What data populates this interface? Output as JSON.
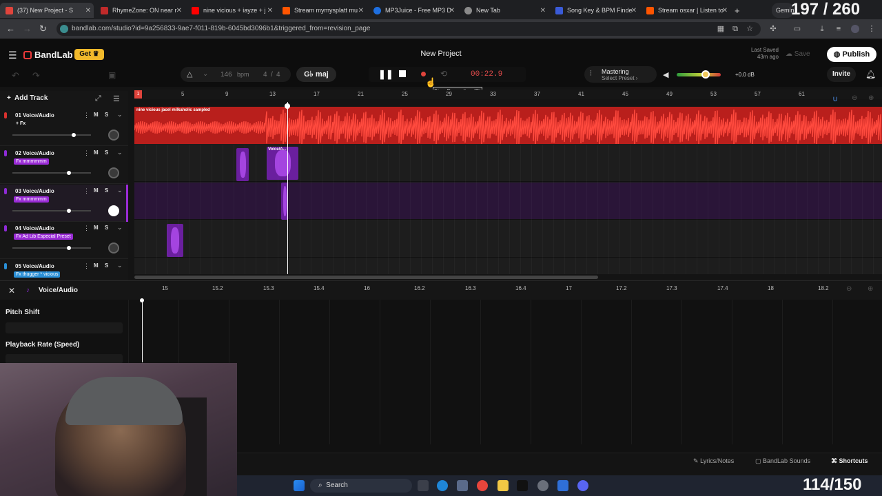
{
  "browser": {
    "tabs": [
      {
        "label": "(37) New Project - S",
        "active": true,
        "favicon_color": "#e0443c"
      },
      {
        "label": "RhymeZone: ON near r",
        "favicon_color": "#c02a2a"
      },
      {
        "label": "nine vicious + iayze + j",
        "favicon_color": "#ff0000"
      },
      {
        "label": "Stream mymysplatt mu",
        "favicon_color": "#ff5500"
      },
      {
        "label": "MP3Juice - Free MP3 D",
        "favicon_color": "#1e6fe0"
      },
      {
        "label": "New Tab",
        "favicon_color": "#8a8a8a"
      },
      {
        "label": "Song Key & BPM Finde",
        "favicon_color": "#3a5bd8"
      },
      {
        "label": "Stream osxar | Listen to",
        "favicon_color": "#ff5500"
      }
    ],
    "new_tab": "+",
    "gemini_label": "Gemini",
    "url": "bandlab.com/studio?id=9a256833-9ae7-f011-819b-6045bd3096b1&triggered_from=revision_page"
  },
  "app": {
    "brand": "BandLab",
    "get_label": "Get",
    "project_title": "New Project",
    "last_saved_label": "Last Saved",
    "last_saved_value": "43m ago",
    "save_label": "Save",
    "publish_label": "Publish",
    "invite_label": "Invite",
    "bpm": "146",
    "bpm_unit": "bpm",
    "time_sig_top": "4",
    "time_sig_sep": "/",
    "time_sig_bottom": "4",
    "key_label": "G♭ maj",
    "timecode": "00:22.9",
    "mastering_label": "Mastering",
    "mastering_preset": "Select Preset ›",
    "volume_db": "+0.0 dB",
    "volume_level": 0.65,
    "tooltip": "Stop Recording (R)",
    "accent_red": "#e0443c"
  },
  "tracks": [
    {
      "name": "01  Voice/Audio",
      "fx": "+ Fx",
      "fx_plain": true,
      "vol": 0.78,
      "color": "#d9312e"
    },
    {
      "name": "02  Voice/Audio",
      "fx": "Fx mmmmmm",
      "fx_plain": false,
      "vol": 0.72,
      "color": "#8e2bd6"
    },
    {
      "name": "03  Voice/Audio",
      "fx": "Fx mmmmmm",
      "fx_plain": false,
      "vol": 0.72,
      "color": "#8e2bd6"
    },
    {
      "name": "04  Voice/Audio",
      "fx": "Fx Ad Lib Especial Preset",
      "fx_plain": false,
      "vol": 0.72,
      "color": "#8e2bd6"
    },
    {
      "name": "05  Voice/Audio",
      "fx": "Fx thugger * vicious",
      "fx_plain": false,
      "vol": 0.72,
      "color": "#2a8fd6"
    }
  ],
  "track_controls": {
    "mute": "M",
    "solo": "S",
    "add_track": "Add Track"
  },
  "timeline": {
    "ruler": [
      "1",
      "5",
      "9",
      "13",
      "17",
      "21",
      "25",
      "29",
      "33",
      "37",
      "41",
      "45",
      "49",
      "53",
      "57",
      "61"
    ],
    "region1_label": "nine vicious  jacel  milkaholic sampled",
    "region2_label": "Voice/A..."
  },
  "editor": {
    "track_label": "Voice/Audio",
    "ruler": [
      "15",
      "15.2",
      "15.3",
      "15.4",
      "16",
      "16.2",
      "16.3",
      "16.4",
      "17",
      "17.2",
      "17.3",
      "17.4",
      "18",
      "18.2"
    ],
    "pitch_shift": "Pitch Shift",
    "playback_rate": "Playback Rate (Speed)"
  },
  "bottom": {
    "lyrics": "Lyrics/Notes",
    "sounds": "BandLab Sounds",
    "shortcuts": "Shortcuts"
  },
  "taskbar": {
    "search": "Search"
  },
  "overlay": {
    "counter_top": "197 / 260",
    "counter_bottom": "114/150"
  }
}
